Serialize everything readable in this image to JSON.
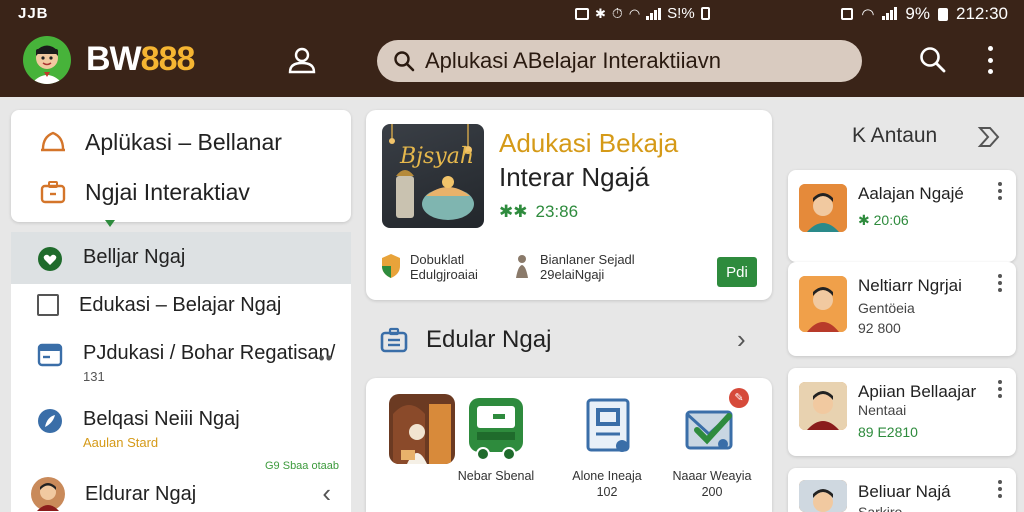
{
  "status_bar": {
    "left_text": "JJB",
    "mid_text": "S!%",
    "battery_text": "9%",
    "time": "212:30"
  },
  "app_bar": {
    "brand_part1": "BW",
    "brand_part2": "888",
    "search_value": "Aplukasi ABelajar Interaktiiavn",
    "colors": {
      "bar": "#3a2418",
      "brand_accent": "#f5b532",
      "logo_bg": "#47b33a"
    }
  },
  "left_menu": {
    "top_items": [
      {
        "label": "Aplükasi – Bellanar",
        "icon": "cap-icon"
      },
      {
        "label": "Ngjai Interaktiav",
        "icon": "briefcase-icon"
      }
    ],
    "items": [
      {
        "label": "Belljar Ngaj",
        "icon": "heart-icon",
        "active": true
      },
      {
        "label": "Edukasi – Belajar Ngaj",
        "icon": "checkbox-icon"
      },
      {
        "label": "PJdukasi / Bohar Regatisan/",
        "sub": "131",
        "icon": "calendar-icon",
        "menu": "••"
      },
      {
        "label": "Belqasi Neiii Ngaj",
        "sub": "Aaulan Stard",
        "icon": "feather-icon"
      },
      {
        "label": "Eldurar Ngaj",
        "icon": "avatar-icon",
        "chevron": "‹"
      }
    ],
    "tag": "G9 Sbaa otaab"
  },
  "featured": {
    "title_line1": "Adukasi Bekaja",
    "title_line2": "Interar Ngajá",
    "rating_icon": "✱✱",
    "rating_value": "23:86",
    "image_text": "Bjsyah",
    "meta1_line1": "Dobuklatl",
    "meta1_line2": "Edulgjroaiai",
    "meta2_line1": "Bianlaner Sejadl",
    "meta2_line2": "29elaiNgaji",
    "button_label": "Pdi"
  },
  "section": {
    "title": "Edular Ngaj",
    "chevron": "›"
  },
  "apps": [
    {
      "name": "",
      "sub": "",
      "icon": "illustration-icon"
    },
    {
      "name": "Nebar Sbenal",
      "sub": "",
      "icon": "bus-icon"
    },
    {
      "name": "Alone Ineaja",
      "sub": "102",
      "icon": "document-icon"
    },
    {
      "name": "Naaar Weayia",
      "sub": "200",
      "icon": "envelope-check-icon",
      "badge": "✎"
    }
  ],
  "right_panel": {
    "header": "K Antaun",
    "header_icon": "share-icon",
    "cards": [
      {
        "title": "Aalajan Ngajé",
        "lines": [
          {
            "text": "✱ 20:06",
            "green": true
          }
        ]
      },
      {
        "title": "Neltiarr Ngrjai",
        "lines": [
          {
            "text": "Gentöeia",
            "green": false
          },
          {
            "text": "92 800",
            "green": false
          }
        ]
      },
      {
        "title": "Apiian Bellaajar",
        "lines": [
          {
            "text": "Nentaai",
            "green": false
          },
          {
            "text": "89 E2810",
            "green": true
          }
        ]
      },
      {
        "title": "Beliuar Najá",
        "lines": [
          {
            "text": "Sarkiro",
            "green": false
          }
        ]
      }
    ]
  }
}
